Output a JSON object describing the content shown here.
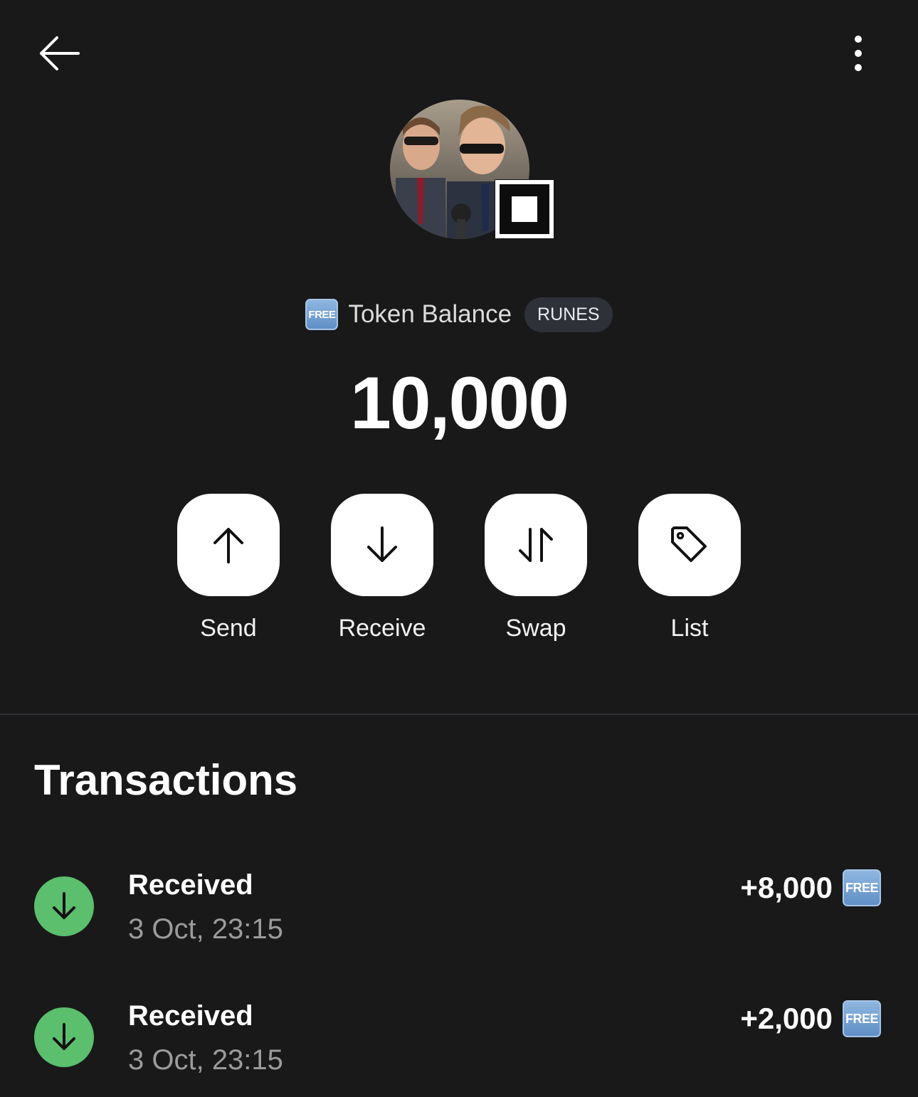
{
  "header": {
    "back_icon": "arrow-left-icon",
    "menu_icon": "more-vertical-icon"
  },
  "token": {
    "emoji_label": "FREE",
    "balance_label": "Token Balance",
    "protocol": "RUNES",
    "balance": "10,000"
  },
  "actions": [
    {
      "label": "Send",
      "icon": "arrow-up-icon"
    },
    {
      "label": "Receive",
      "icon": "arrow-down-icon"
    },
    {
      "label": "Swap",
      "icon": "swap-icon"
    },
    {
      "label": "List",
      "icon": "tag-icon"
    }
  ],
  "transactions": {
    "title": "Transactions",
    "items": [
      {
        "type": "Received",
        "time": "3 Oct, 23:15",
        "amount": "+8,000",
        "token_label": "FREE"
      },
      {
        "type": "Received",
        "time": "3 Oct, 23:15",
        "amount": "+2,000",
        "token_label": "FREE"
      }
    ]
  },
  "colors": {
    "background": "#19191a",
    "received_green": "#5bbf6e",
    "pill_bg": "#2e3138"
  }
}
